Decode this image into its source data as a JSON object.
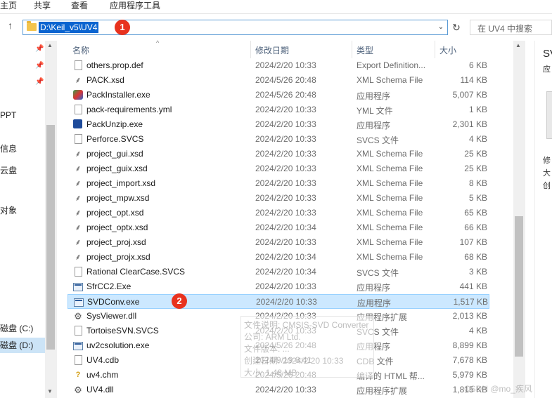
{
  "ribbon": {
    "tabs": [
      "主页",
      "共享",
      "查看",
      "应用程序工具"
    ]
  },
  "address": {
    "path": "D:\\Keil_v5\\UV4",
    "search_placeholder": "在 UV4 中搜索"
  },
  "annotations": {
    "badge1": "1",
    "badge2": "2"
  },
  "nav": {
    "items": [
      "",
      "",
      "",
      "",
      "",
      "PPT",
      "",
      "信息",
      "",
      "云盘",
      "",
      "",
      "对象",
      "",
      "",
      "",
      "",
      "",
      "",
      "磁盘 (C:)",
      "磁盘 (D:)"
    ]
  },
  "columns": {
    "name": "名称",
    "date": "修改日期",
    "type": "类型",
    "size": "大小"
  },
  "files": [
    {
      "icon": "document-icon",
      "name": "others.prop.def",
      "date": "2024/2/20 10:33",
      "type": "Export Definition...",
      "size": "6 KB"
    },
    {
      "icon": "xsd-schema-icon",
      "name": "PACK.xsd",
      "date": "2024/5/26 20:48",
      "type": "XML Schema File",
      "size": "114 KB"
    },
    {
      "icon": "pack-installer-icon",
      "name": "PackInstaller.exe",
      "date": "2024/5/26 20:48",
      "type": "应用程序",
      "size": "5,007 KB"
    },
    {
      "icon": "document-icon",
      "name": "pack-requirements.yml",
      "date": "2024/2/20 10:33",
      "type": "YML 文件",
      "size": "1 KB"
    },
    {
      "icon": "pack-unzip-icon",
      "name": "PackUnzip.exe",
      "date": "2024/2/20 10:33",
      "type": "应用程序",
      "size": "2,301 KB"
    },
    {
      "icon": "document-icon",
      "name": "Perforce.SVCS",
      "date": "2024/2/20 10:33",
      "type": "SVCS 文件",
      "size": "4 KB"
    },
    {
      "icon": "xsd-schema-icon",
      "name": "project_gui.xsd",
      "date": "2024/2/20 10:33",
      "type": "XML Schema File",
      "size": "25 KB"
    },
    {
      "icon": "xsd-schema-icon",
      "name": "project_guix.xsd",
      "date": "2024/2/20 10:33",
      "type": "XML Schema File",
      "size": "25 KB"
    },
    {
      "icon": "xsd-schema-icon",
      "name": "project_import.xsd",
      "date": "2024/2/20 10:33",
      "type": "XML Schema File",
      "size": "8 KB"
    },
    {
      "icon": "xsd-schema-icon",
      "name": "project_mpw.xsd",
      "date": "2024/2/20 10:33",
      "type": "XML Schema File",
      "size": "5 KB"
    },
    {
      "icon": "xsd-schema-icon",
      "name": "project_opt.xsd",
      "date": "2024/2/20 10:33",
      "type": "XML Schema File",
      "size": "65 KB"
    },
    {
      "icon": "xsd-schema-icon",
      "name": "project_optx.xsd",
      "date": "2024/2/20 10:34",
      "type": "XML Schema File",
      "size": "66 KB"
    },
    {
      "icon": "xsd-schema-icon",
      "name": "project_proj.xsd",
      "date": "2024/2/20 10:33",
      "type": "XML Schema File",
      "size": "107 KB"
    },
    {
      "icon": "xsd-schema-icon",
      "name": "project_projx.xsd",
      "date": "2024/2/20 10:34",
      "type": "XML Schema File",
      "size": "68 KB"
    },
    {
      "icon": "document-icon",
      "name": "Rational ClearCase.SVCS",
      "date": "2024/2/20 10:34",
      "type": "SVCS 文件",
      "size": "3 KB"
    },
    {
      "icon": "exe-icon",
      "name": "SfrCC2.Exe",
      "date": "2024/2/20 10:33",
      "type": "应用程序",
      "size": "441 KB"
    },
    {
      "icon": "exe-icon",
      "name": "SVDConv.exe",
      "date": "2024/2/20 10:33",
      "type": "应用程序",
      "size": "1,517 KB",
      "selected": true
    },
    {
      "icon": "dll-gear-icon",
      "name": "SysViewer.dll",
      "date": "2024/2/20 10:33",
      "type": "应用程序扩展",
      "size": "2,013 KB"
    },
    {
      "icon": "document-icon",
      "name": "TortoiseSVN.SVCS",
      "date": "2024/2/20 10:33",
      "type": "SVCS 文件",
      "size": "4 KB"
    },
    {
      "icon": "exe-icon",
      "name": "uv2csolution.exe",
      "date": "2024/5/26 20:48",
      "type": "应用程序",
      "size": "8,899 KB"
    },
    {
      "icon": "document-icon",
      "name": "UV4.cdb",
      "date": "2024/9/19 8:41",
      "type": "CDB 文件",
      "size": "7,678 KB"
    },
    {
      "icon": "chm-help-icon",
      "name": "uv4.chm",
      "date": "2024/5/26 20:48",
      "type": "编译的 HTML 帮...",
      "size": "5,979 KB"
    },
    {
      "icon": "dll-gear-icon",
      "name": "UV4.dll",
      "date": "2024/2/20 10:33",
      "type": "应用程序扩展",
      "size": "1,815 KB"
    }
  ],
  "tooltip": {
    "lines": [
      "文件说明: CMSIS-SVD Converter",
      "公司: ARM Ltd.",
      "文件版本: ...",
      "创建日期: 2024/2/20 10:33",
      "大小: 1.48 MB"
    ]
  },
  "details": {
    "title": "SVD",
    "subtitle": "应",
    "lines": [
      "修",
      "大",
      "创"
    ]
  },
  "watermark": "CSDN @mo_疾风"
}
